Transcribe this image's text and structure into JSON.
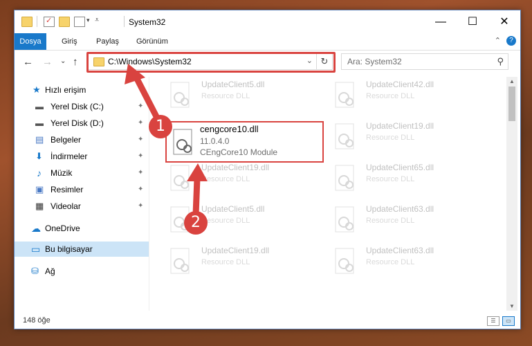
{
  "window": {
    "title": "System32",
    "controls": {
      "minimize": "—",
      "maximize": "☐",
      "close": "✕"
    }
  },
  "ribbon": {
    "tabs": [
      "Dosya",
      "Giriş",
      "Paylaş",
      "Görünüm"
    ],
    "help": "?",
    "collapse": "⌃"
  },
  "navigation": {
    "back": "←",
    "forward": "→",
    "recent": "⌄",
    "up": "↑"
  },
  "address": {
    "path": "C:\\Windows\\System32",
    "dropdown": "⌄",
    "refresh": "↻"
  },
  "search": {
    "placeholder": "Ara: System32",
    "icon": "⚲"
  },
  "sidebar": {
    "items": [
      {
        "label": "Hızlı erişim",
        "icon": "star-icon",
        "glyph": "★",
        "color": "#1979ca",
        "pinned": false
      },
      {
        "label": "Yerel Disk (C:)",
        "icon": "drive-icon",
        "glyph": "▬",
        "color": "#555555",
        "pinned": true
      },
      {
        "label": "Yerel Disk (D:)",
        "icon": "drive-icon",
        "glyph": "▬",
        "color": "#555555",
        "pinned": true
      },
      {
        "label": "Belgeler",
        "icon": "documents-icon",
        "glyph": "▤",
        "color": "#4a79c4",
        "pinned": true
      },
      {
        "label": "İndirmeler",
        "icon": "download-icon",
        "glyph": "⬇",
        "color": "#1979ca",
        "pinned": true
      },
      {
        "label": "Müzik",
        "icon": "music-icon",
        "glyph": "♪",
        "color": "#1979ca",
        "pinned": true
      },
      {
        "label": "Resimler",
        "icon": "pictures-icon",
        "glyph": "▣",
        "color": "#4a79c4",
        "pinned": true
      },
      {
        "label": "Videolar",
        "icon": "videos-icon",
        "glyph": "▦",
        "color": "#333333",
        "pinned": true
      },
      {
        "label": "OneDrive",
        "icon": "cloud-icon",
        "glyph": "☁",
        "color": "#1979ca",
        "pinned": false
      },
      {
        "label": "Bu bilgisayar",
        "icon": "computer-icon",
        "glyph": "▭",
        "color": "#1979ca",
        "pinned": false,
        "selected": true
      },
      {
        "label": "Ağ",
        "icon": "network-icon",
        "glyph": "⛁",
        "color": "#1979ca",
        "pinned": false
      }
    ],
    "pin_glyph": "📌"
  },
  "files": {
    "left_column": [
      {
        "name": "UpdateClient5.dll",
        "type": "Resource DLL"
      },
      {
        "name": "cengcore10.dll",
        "version": "11.0.4.0",
        "description": "CEngCore10 Module",
        "highlighted": true
      },
      {
        "name": "UpdateClient19.dll",
        "type": "Resource DLL"
      },
      {
        "name": "UpdateClient5.dll",
        "type": "Resource DLL"
      },
      {
        "name": "UpdateClient19.dll",
        "type": "Resource DLL"
      }
    ],
    "right_column": [
      {
        "name": "UpdateClient42.dll",
        "type": "Resource DLL"
      },
      {
        "name": "UpdateClient19.dll",
        "type": "Resource DLL"
      },
      {
        "name": "UpdateClient65.dll",
        "type": "Resource DLL"
      },
      {
        "name": "UpdateClient63.dll",
        "type": "Resource DLL"
      },
      {
        "name": "UpdateClient63.dll",
        "type": "Resource DLL"
      }
    ]
  },
  "status": {
    "count": "148 öğe"
  },
  "annotations": {
    "callout_1": "1",
    "callout_2": "2",
    "accent": "#d9433f"
  },
  "colors": {
    "accent": "#1979ca",
    "highlight": "#d9433f",
    "selected": "#cce4f7"
  }
}
